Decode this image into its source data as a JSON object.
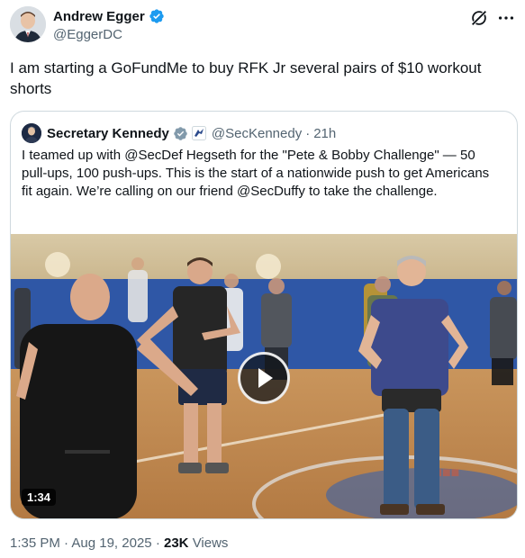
{
  "author": {
    "name": "Andrew Egger",
    "handle": "@EggerDC"
  },
  "tweet": {
    "text": "I am starting a GoFundMe to buy RFK Jr several pairs of $10 workout shorts"
  },
  "quote": {
    "name": "Secretary Kennedy",
    "handle": "@SecKennedy",
    "separator": "·",
    "time": "21h",
    "text": "I teamed up with @SecDef Hegseth for the \"Pete & Bobby Challenge\" — 50 pull-ups, 100 push-ups. This is the start of a nationwide push to get Americans fit again. We’re calling on our friend @SecDuffy to take the challenge.",
    "video": {
      "duration": "1:34"
    }
  },
  "meta": {
    "time": "1:35 PM",
    "separator": "·",
    "date": "Aug 19, 2025",
    "separator2": "·",
    "views_count": "23K",
    "views_label": "Views"
  },
  "colors": {
    "verified_blue": "#1d9bf0",
    "secondary_text": "#536471",
    "primary_text": "#0f1419",
    "border": "#cfd9de"
  },
  "icons": [
    "verified-badge-icon",
    "grok-icon",
    "more-icon",
    "government-affiliation-icon",
    "play-icon"
  ]
}
